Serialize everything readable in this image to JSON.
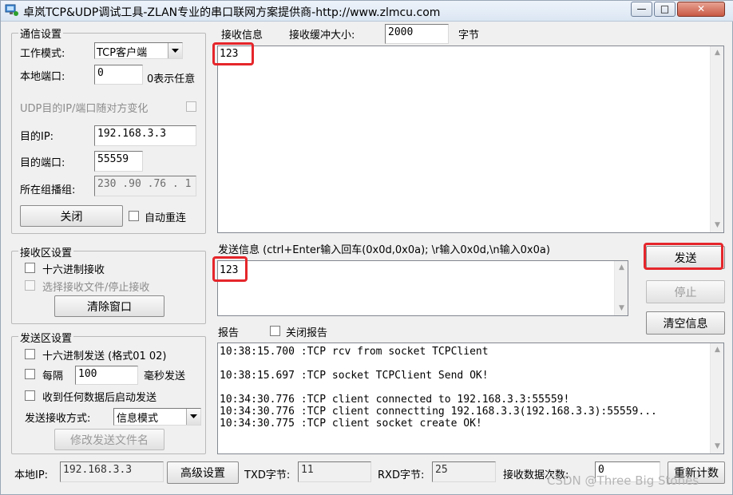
{
  "window": {
    "title": "卓岚TCP&UDP调试工具-ZLAN专业的串口联网方案提供商-http://www.zlmcu.com",
    "minimize_label": "—",
    "maximize_label": "□",
    "close_label": "✕"
  },
  "comm": {
    "group_label": "通信设置",
    "mode_label": "工作模式:",
    "mode_value": "TCP客户端",
    "local_port_label": "本地端口:",
    "local_port_value": "0",
    "local_port_hint": "0表示任意",
    "udp_label": "UDP目的IP/端口随对方变化",
    "dest_ip_label": "目的IP:",
    "dest_ip_value": "192.168.3.3",
    "dest_port_label": "目的端口:",
    "dest_port_value": "55559",
    "multicast_label": "所在组播组:",
    "multicast_value": "230 .90 .76 . 1",
    "close_button": "关闭",
    "auto_reconnect_label": "自动重连"
  },
  "recv_settings": {
    "group_label": "接收区设置",
    "hex_label": "十六进制接收",
    "file_label": "选择接收文件/停止接收",
    "clear_button": "清除窗口"
  },
  "send_settings": {
    "group_label": "发送区设置",
    "hex_label": "十六进制发送 (格式01 02)",
    "every_label": "每隔",
    "every_value": "100",
    "ms_label": "毫秒发送",
    "after_recv_label": "收到任何数据后启动发送",
    "mode_label": "发送接收方式:",
    "mode_value": "信息模式",
    "modify_button": "修改发送文件名"
  },
  "receive": {
    "label": "接收信息",
    "buffer_label": "接收缓冲大小:",
    "buffer_value": "2000",
    "unit_label": "字节",
    "content": "123"
  },
  "send": {
    "label": "发送信息 (ctrl+Enter输入回车(0x0d,0x0a); \\r输入0x0d,\\n输入0x0a)",
    "content": "123",
    "send_button": "发送",
    "stop_button": "停止",
    "clear_info_button": "清空信息"
  },
  "report": {
    "label": "报告",
    "close_report_label": "关闭报告",
    "lines": [
      "10:38:15.700 :TCP rcv from socket TCPClient",
      "",
      "10:38:15.697 :TCP socket TCPClient Send OK!",
      "",
      "10:34:30.776 :TCP client connected to 192.168.3.3:55559!",
      "10:34:30.776 :TCP client connectting 192.168.3.3(192.168.3.3):55559...",
      "10:34:30.775 :TCP client socket create OK!"
    ]
  },
  "status": {
    "local_ip_label": "本地IP:",
    "local_ip_value": "192.168.3.3",
    "advanced_button": "高级设置",
    "txd_label": "TXD字节:",
    "txd_value": "11",
    "rxd_label": "RXD字节:",
    "rxd_value": "25",
    "recv_count_label": "接收数据次数:",
    "recv_count_value": "0",
    "recount_button": "重新计数"
  },
  "watermark": "CSDN @Three Big Stones",
  "colors": {
    "highlight": "#e5262b"
  }
}
